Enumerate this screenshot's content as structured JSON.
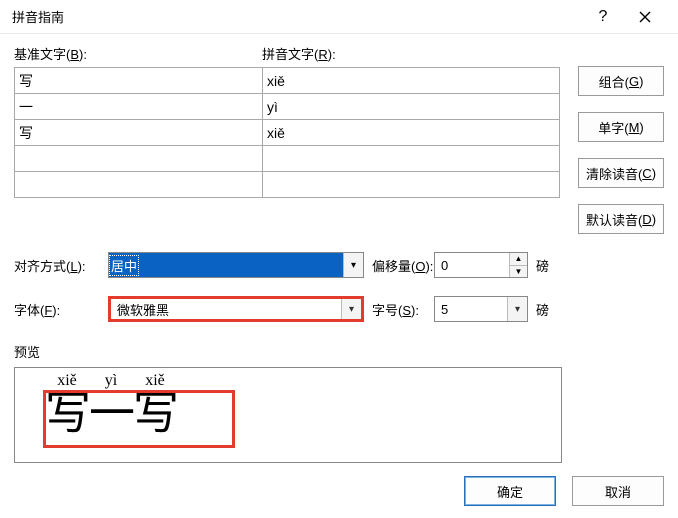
{
  "title": "拼音指南",
  "headers": {
    "base": "基准文字(B):",
    "ruby": "拼音文字(R):"
  },
  "rows": [
    {
      "base": "写",
      "ruby": "xiě"
    },
    {
      "base": "一",
      "ruby": "yì"
    },
    {
      "base": "写",
      "ruby": "xiě"
    },
    {
      "base": "",
      "ruby": ""
    },
    {
      "base": "",
      "ruby": ""
    }
  ],
  "side_buttons": {
    "group": "组合(G)",
    "single": "单字(M)",
    "clear": "清除读音(C)",
    "default": "默认读音(D)"
  },
  "labels": {
    "align": "对齐方式(L):",
    "offset": "偏移量(O):",
    "font": "字体(F):",
    "size": "字号(S):",
    "pt": "磅",
    "preview": "预览"
  },
  "values": {
    "align": "居中",
    "offset": "0",
    "font": "微软雅黑",
    "size": "5"
  },
  "preview": {
    "items": [
      {
        "rt": "xiě",
        "rb": "写"
      },
      {
        "rt": "yì",
        "rb": "一"
      },
      {
        "rt": "xiě",
        "rb": "写"
      }
    ]
  },
  "footer": {
    "ok": "确定",
    "cancel": "取消"
  }
}
